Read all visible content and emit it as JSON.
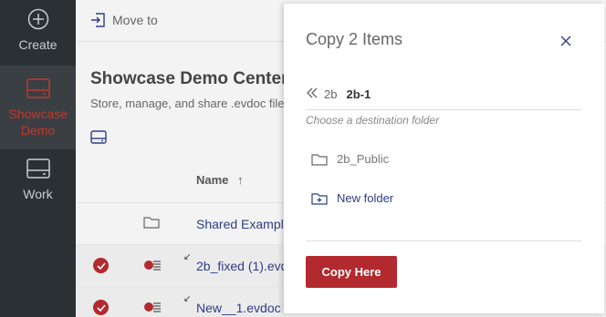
{
  "sidebar": {
    "items": [
      {
        "label": "Create",
        "icon": "plus-circle-icon"
      },
      {
        "label": "Showcase Demo",
        "icon": "showcase-icon",
        "active": true
      },
      {
        "label": "Work",
        "icon": "work-icon"
      }
    ]
  },
  "toolbar": {
    "move_to_label": "Move to"
  },
  "main": {
    "title": "Showcase Demo Center",
    "subtitle": "Store, manage, and share .evdoc files",
    "column_name": "Name",
    "rows": [
      {
        "name": "Shared Example",
        "type": "folder",
        "selected": false
      },
      {
        "name": "2b_fixed (1).evdoc",
        "type": "evdoc",
        "selected": true
      },
      {
        "name": "New__1.evdoc",
        "type": "evdoc",
        "selected": true
      }
    ]
  },
  "modal": {
    "title": "Copy 2 Items",
    "breadcrumb_prev": "2b",
    "breadcrumb_current": "2b-1",
    "hint": "Choose a destination folder",
    "folders": [
      "2b_Public"
    ],
    "new_folder_label": "New folder",
    "copy_button": "Copy Here"
  },
  "colors": {
    "accent": "#b22a2e",
    "link": "#2e3d86",
    "sidebar": "#2b3035"
  }
}
